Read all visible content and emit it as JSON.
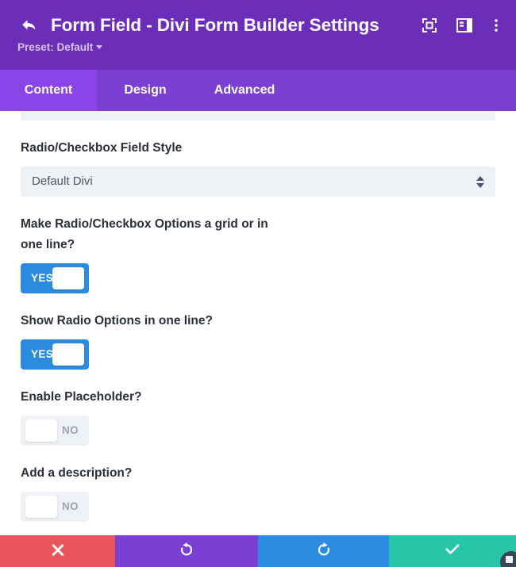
{
  "header": {
    "back_icon": "back-arrow-icon",
    "title": "Form Field - Divi Form Builder Settings",
    "preset_label": "Preset: Default",
    "actions": [
      {
        "name": "focus-mode-icon",
        "label": "Focus Mode"
      },
      {
        "name": "layout-panel-icon",
        "label": "Layout"
      },
      {
        "name": "kebab-menu-icon",
        "label": "More Options"
      }
    ],
    "colors": {
      "background": "#6C2EB9",
      "title_text": "#FFFFFF",
      "preset_text": "#D7C2EE"
    }
  },
  "tabs": {
    "items": [
      {
        "label": "Content",
        "active": true
      },
      {
        "label": "Design",
        "active": false
      },
      {
        "label": "Advanced",
        "active": false
      }
    ],
    "colors": {
      "bar": "#7B3FD4",
      "active": "#8B44E8",
      "text": "#FFFFFF"
    }
  },
  "settings": {
    "select_field": {
      "label": "Radio/Checkbox Field Style",
      "value": "Default Divi",
      "spinner_icon": "select-spinner-icon"
    },
    "toggles": [
      {
        "label": "Make Radio/Checkbox Options a grid or in one line?",
        "state": "YES",
        "on": true
      },
      {
        "label": "Show Radio Options in one line?",
        "state": "YES",
        "on": true
      },
      {
        "label": "Enable Placeholder?",
        "state": "NO",
        "on": false
      },
      {
        "label": "Add a description?",
        "state": "NO",
        "on": false
      }
    ],
    "colors": {
      "label_text": "#2B3038",
      "input_bg": "#EEF1F6",
      "toggle_on": "#2C8BE0",
      "toggle_off": "#EEF1F6",
      "toggle_off_text": "#9AA5B4"
    }
  },
  "action_bar": {
    "buttons": [
      {
        "name": "cancel-button",
        "icon": "close-x-icon",
        "color": "#E8555B"
      },
      {
        "name": "undo-button",
        "icon": "undo-arrow-icon",
        "color": "#7B3FD4"
      },
      {
        "name": "redo-button",
        "icon": "redo-arrow-icon",
        "color": "#2C8BE0"
      },
      {
        "name": "save-button",
        "icon": "checkmark-icon",
        "color": "#26C6A6"
      }
    ]
  }
}
